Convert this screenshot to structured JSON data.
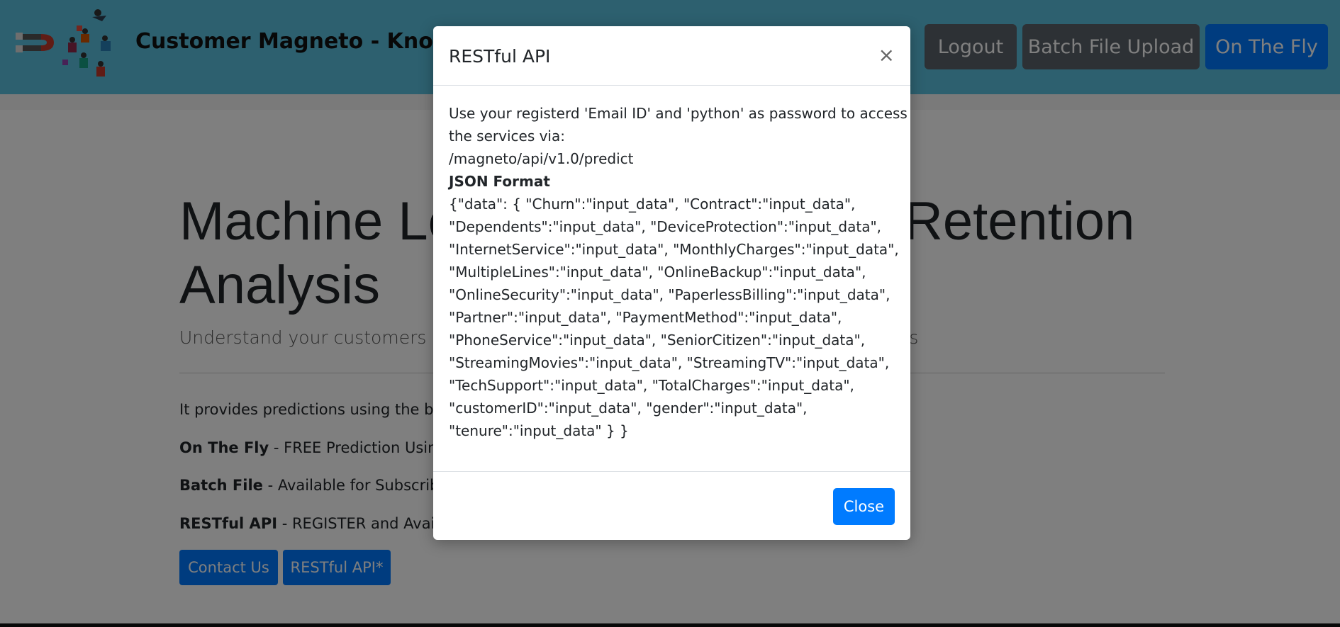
{
  "navbar": {
    "brand": "Customer Magneto - Know",
    "logout_label": "Logout",
    "batch_label": "Batch File Upload",
    "onthefly_label": "On The Fly"
  },
  "hero": {
    "title_line1_left": "Machine Le",
    "title_line1_right": "Retention",
    "title_line2": "Analysis",
    "lead_left": "Understand your customers bet",
    "lead_right": "els",
    "p1": "It provides predictions using the best",
    "p2_bold": "On The Fly",
    "p2_rest": " - FREE Prediction Using O",
    "p3_bold": "Batch File",
    "p3_rest": " - Available for Subscribed U",
    "p4_bold": "RESTful API",
    "p4_rest": " - REGISTER and Avail Ou",
    "contact_label": "Contact Us",
    "restful_label": "RESTful API*"
  },
  "modal": {
    "title": "RESTful API",
    "close_x": "×",
    "body_lines": [
      "Use your registerd 'Email ID' and 'python' as password to access",
      "the services via:",
      "/magneto/api/v1.0/predict"
    ],
    "json_heading": "JSON Format",
    "json_lines": [
      "{\"data\": { \"Churn\":\"input_data\", \"Contract\":\"input_data\",",
      "\"Dependents\":\"input_data\", \"DeviceProtection\":\"input_data\",",
      "\"InternetService\":\"input_data\", \"MonthlyCharges\":\"input_data\",",
      "\"MultipleLines\":\"input_data\", \"OnlineBackup\":\"input_data\",",
      "\"OnlineSecurity\":\"input_data\", \"PaperlessBilling\":\"input_data\",",
      "\"Partner\":\"input_data\", \"PaymentMethod\":\"input_data\",",
      "\"PhoneService\":\"input_data\", \"SeniorCitizen\":\"input_data\",",
      "\"StreamingMovies\":\"input_data\", \"StreamingTV\":\"input_data\",",
      "\"TechSupport\":\"input_data\", \"TotalCharges\":\"input_data\",",
      "\"customerID\":\"input_data\", \"gender\":\"input_data\",",
      "\"tenure\":\"input_data\" } }"
    ],
    "close_button_label": "Close"
  }
}
